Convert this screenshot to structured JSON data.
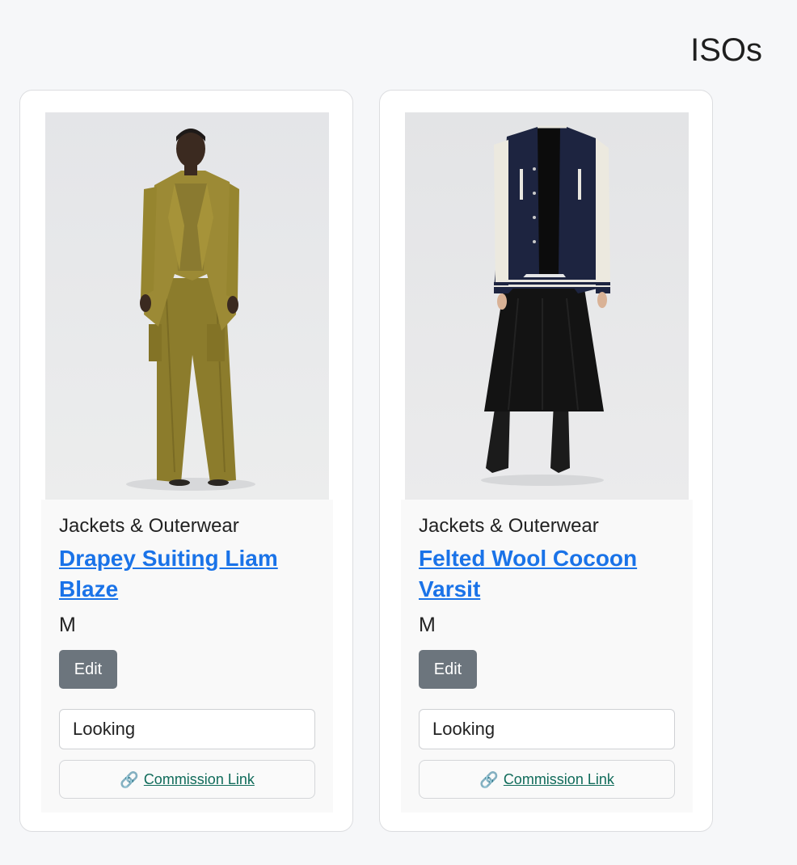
{
  "page": {
    "title": "ISOs"
  },
  "items": [
    {
      "category": "Jackets & Outerwear",
      "name": "Drapey Suiting Liam Blaze",
      "size": "M",
      "edit_label": "Edit",
      "status": "Looking",
      "commission_label": "Commission Link",
      "commission_icon": "link-icon",
      "image_alt": "Model in olive drapey suiting blazer and cargo trousers"
    },
    {
      "category": "Jackets & Outerwear",
      "name": "Felted Wool Cocoon Varsit",
      "size": "M",
      "edit_label": "Edit",
      "status": "Looking",
      "commission_label": "Commission Link",
      "commission_icon": "link-icon",
      "image_alt": "Model in navy varsity jacket with cream sleeves and black skirt"
    }
  ],
  "colors": {
    "link_blue": "#1a73e8",
    "edit_button_gray": "#6c757d",
    "commission_green": "#106b5a",
    "page_background": "#f6f7f9"
  }
}
